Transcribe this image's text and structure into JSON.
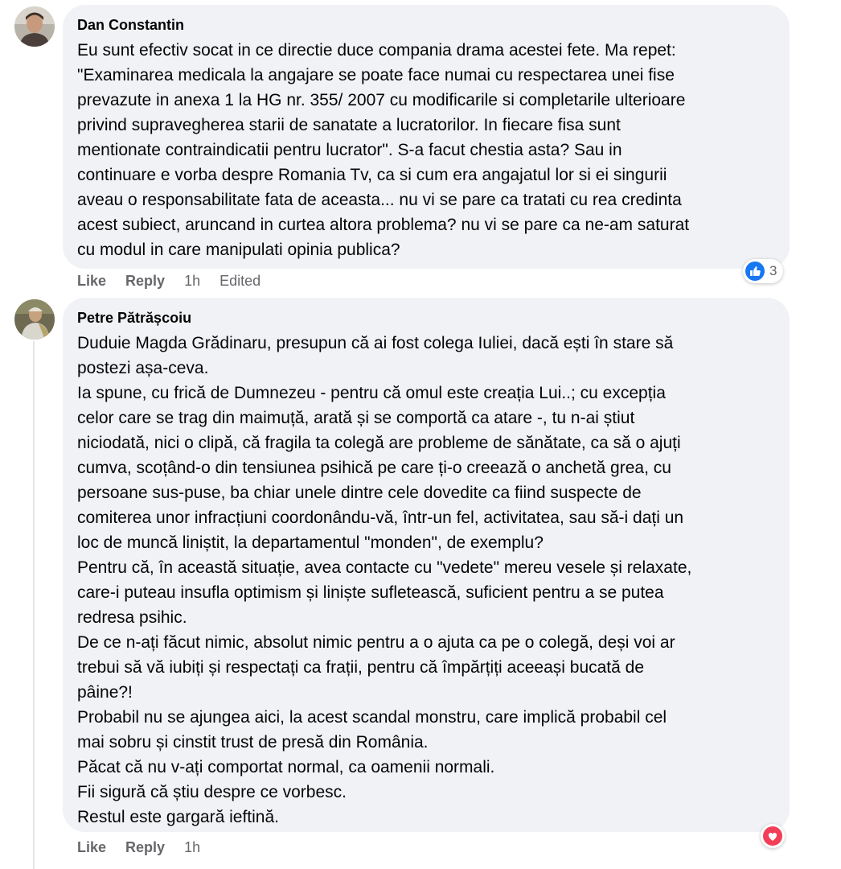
{
  "comments": [
    {
      "author": "Dan Constantin",
      "text": "Eu sunt efectiv socat in ce directie duce compania drama acestei fete. Ma repet:\n\"Examinarea medicala la angajare se poate face numai cu respectarea unei fise\nprevazute in anexa 1 la HG nr. 355/ 2007 cu modificarile si completarile ulterioare\nprivind supravegherea starii de sanatate a lucratorilor. In fiecare fisa sunt\nmentionate contraindicatii pentru lucrator\". S-a facut chestia asta? Sau in\ncontinuare e vorba despre Romania Tv, ca si cum era angajatul lor si ei singurii\naveau o responsabilitate fata de aceasta... nu vi se pare ca tratati cu rea credinta\nacest subiect, aruncand in curtea altora problema? nu vi se pare ca ne-am saturat\ncu modul in care manipulati opinia publica?",
      "like": "Like",
      "reply": "Reply",
      "time": "1h",
      "edited": "Edited",
      "reaction_icon": "like-icon",
      "reaction_count": "3"
    },
    {
      "author": "Petre Pătrășcoiu",
      "text": "Duduie Magda Grădinaru, presupun că ai fost colega Iuliei, dacă ești în stare să\npostezi așa-ceva.\nIa spune, cu frică de Dumnezeu - pentru că omul este creația Lui..; cu excepția\ncelor care se trag din maimuță, arată și se comportă ca atare -, tu n-ai știut\nniciodată, nici o clipă, că fragila ta colegă are probleme de sănătate, ca să o ajuți\ncumva, scoțând-o din tensiunea psihică pe care ți-o creează o anchetă grea, cu\npersoane sus-puse, ba chiar unele dintre cele dovedite ca fiind suspecte de\ncomiterea unor infracțiuni coordonându-vă, într-un fel, activitatea, sau să-i dați un\nloc de muncă liniștit, la departamentul \"monden\", de exemplu?\nPentru că, în această situație, avea contacte cu \"vedete\" mereu vesele și relaxate,\ncare-i puteau insufla optimism și liniște sufletească, suficient pentru a se putea\nredresa psihic.\nDe ce n-ați făcut nimic, absolut nimic pentru a o ajuta ca pe o colegă, deși voi ar\ntrebui să vă iubiți și respectați ca frații, pentru că împărțiți aceeași bucată de\npâine?!\nProbabil nu se ajungea aici, la acest scandal monstru, care implică probabil cel\nmai sobru și cinstit trust de presă din România.\nPăcat că nu v-ați comportat normal, ca oamenii normali.\nFii sigură că știu despre ce vorbesc.\nRestul este gargară ieftină.",
      "like": "Like",
      "reply": "Reply",
      "time": "1h",
      "reaction_icon": "love-icon"
    }
  ],
  "colors": {
    "bubble": "#f0f2f5",
    "muted_text": "#65676b",
    "like_blue": "#1877f2",
    "love_red": "#f33e58"
  }
}
